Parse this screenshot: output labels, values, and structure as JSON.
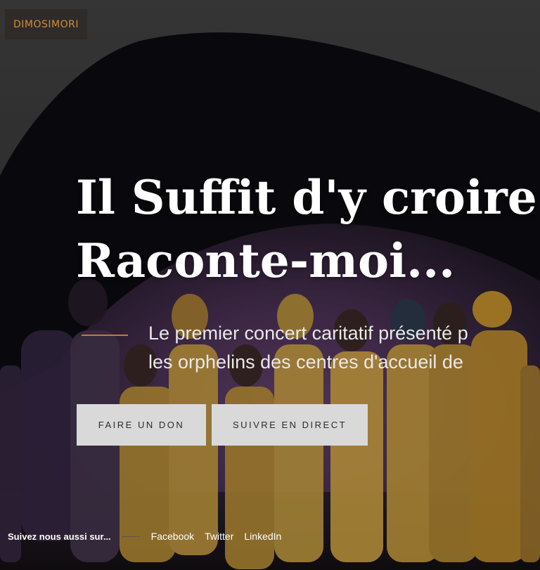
{
  "brand": {
    "logo_text": "DIMOSIMORI",
    "accent_color": "#d58a3a"
  },
  "hero": {
    "headline_line1": "Il Suffit d'y croire",
    "headline_line2": "Raconte-moi...",
    "subtitle_line1": "Le premier concert caritatif présenté p",
    "subtitle_line2": "les orphelins des centres d'accueil de",
    "buttons": {
      "donate_label": "FAIRE UN DON",
      "live_label": "SUIVRE EN DIRECT"
    }
  },
  "social": {
    "label": "Suivez nous aussi sur...",
    "links": [
      "Facebook",
      "Twitter",
      "LinkedIn"
    ]
  }
}
